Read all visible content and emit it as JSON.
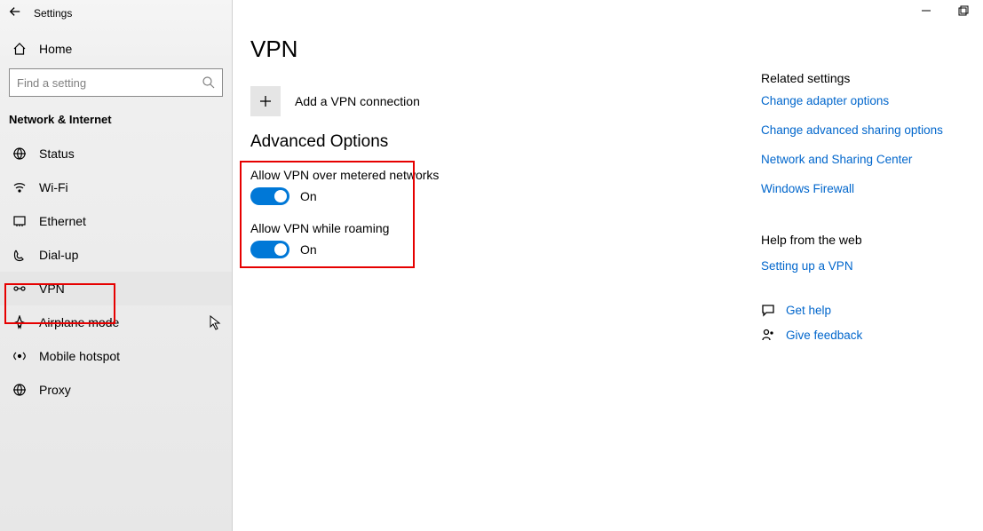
{
  "titlebar": {
    "app": "Settings"
  },
  "sidebar": {
    "home_label": "Home",
    "search_placeholder": "Find a setting",
    "section_title": "Network & Internet",
    "items": [
      {
        "label": "Status"
      },
      {
        "label": "Wi-Fi"
      },
      {
        "label": "Ethernet"
      },
      {
        "label": "Dial-up"
      },
      {
        "label": "VPN"
      },
      {
        "label": "Airplane mode"
      },
      {
        "label": "Mobile hotspot"
      },
      {
        "label": "Proxy"
      }
    ]
  },
  "main": {
    "page_title": "VPN",
    "add_label": "Add a VPN connection",
    "adv_header": "Advanced Options",
    "opt1_label": "Allow VPN over metered networks",
    "opt1_state": "On",
    "opt2_label": "Allow VPN while roaming",
    "opt2_state": "On"
  },
  "related": {
    "header": "Related settings",
    "links": [
      "Change adapter options",
      "Change advanced sharing options",
      "Network and Sharing Center",
      "Windows Firewall"
    ]
  },
  "help": {
    "header": "Help from the web",
    "links": [
      "Setting up a VPN"
    ]
  },
  "support": {
    "get_help": "Get help",
    "feedback": "Give feedback"
  },
  "annotation": {
    "highlight_color": "#e60000",
    "highlighted_nav_item": "VPN",
    "highlighted_section": "Advanced Options"
  }
}
